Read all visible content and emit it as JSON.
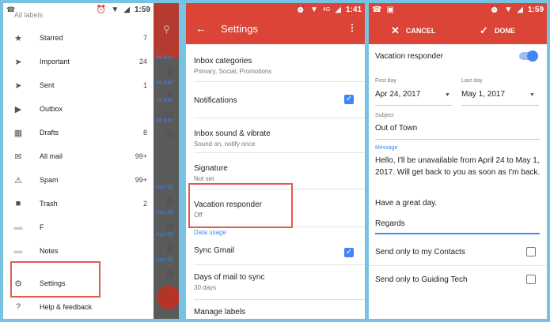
{
  "status_bar": {
    "time_1": "1:59",
    "time_2": "1:41",
    "time_3": "1:59",
    "network": "4G"
  },
  "drawer": {
    "header": "All labels",
    "items": [
      {
        "label": "Starred",
        "count": "7",
        "icon": "star-icon"
      },
      {
        "label": "Important",
        "count": "24",
        "icon": "important-icon"
      },
      {
        "label": "Sent",
        "count": "1",
        "icon": "send-icon"
      },
      {
        "label": "Outbox",
        "count": "",
        "icon": "outbox-icon"
      },
      {
        "label": "Drafts",
        "count": "8",
        "icon": "drafts-icon"
      },
      {
        "label": "All mail",
        "count": "99+",
        "icon": "mail-icon"
      },
      {
        "label": "Spam",
        "count": "99+",
        "icon": "spam-icon"
      },
      {
        "label": "Trash",
        "count": "2",
        "icon": "trash-icon"
      },
      {
        "label": "F",
        "count": "",
        "icon": "label-icon"
      },
      {
        "label": "Notes",
        "count": "",
        "icon": "label-icon"
      },
      {
        "label": "Settings",
        "count": "",
        "icon": "gear-icon"
      },
      {
        "label": "Help & feedback",
        "count": "",
        "icon": "help-icon"
      }
    ],
    "background_times": [
      "00 AM",
      "00 AM",
      "15 AM",
      "05 AM",
      "Apr 23",
      "Apr 23",
      "Apr 23",
      "Apr 23"
    ]
  },
  "settings": {
    "title": "Settings",
    "items": [
      {
        "main": "Inbox categories",
        "sub": "Primary, Social, Promotions"
      },
      {
        "main": "Notifications",
        "sub": ""
      },
      {
        "main": "Inbox sound & vibrate",
        "sub": "Sound on, notify once"
      },
      {
        "main": "Signature",
        "sub": "Not set"
      },
      {
        "main": "Vacation responder",
        "sub": "Off"
      }
    ],
    "section_header": "Data usage",
    "data_items": [
      {
        "main": "Sync Gmail",
        "sub": ""
      },
      {
        "main": "Days of mail to sync",
        "sub": "30 days"
      },
      {
        "main": "Manage labels",
        "sub": ""
      }
    ]
  },
  "vacation": {
    "cancel_label": "CANCEL",
    "done_label": "DONE",
    "responder_label": "Vacation responder",
    "first_day_label": "First day",
    "first_day_value": "Apr 24, 2017",
    "last_day_label": "Last day",
    "last_day_value": "May 1, 2017",
    "subject_label": "Subject",
    "subject_value": "Out of Town",
    "message_label": "Message",
    "message_line1": "Hello, I'll be unavailable from April 24 to May 1, 2017. Will get back to you as soon as I'm back.",
    "message_line2": "Have a great day.",
    "message_line3": "Regards",
    "contacts_label": "Send only to my Contacts",
    "guiding_label": "Send only to Guiding Tech"
  },
  "colors": {
    "appbar_red": "#db4437",
    "accent_blue": "#4285f4",
    "highlight_red": "#e05a4f",
    "frame_blue": "#76c3e4"
  }
}
